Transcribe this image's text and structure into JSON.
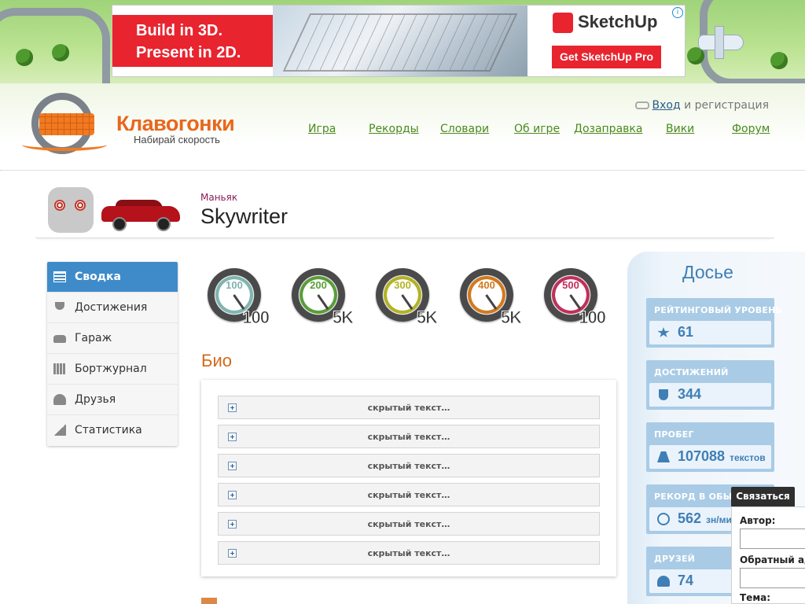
{
  "ad": {
    "headline_line1": "Build in 3D.",
    "headline_line2": "Present in 2D.",
    "brand": "SketchUp",
    "cta": "Get SketchUp Pro",
    "info_glyph": "i"
  },
  "site": {
    "logo_title": "Клавогонки",
    "logo_subtitle": "Набирай скорость",
    "login_link": "Вход",
    "login_rest": "и регистрация"
  },
  "nav": [
    {
      "label": "Игра"
    },
    {
      "label": "Рекорды"
    },
    {
      "label": "Словари"
    },
    {
      "label": "Об игре"
    },
    {
      "label": "Дозаправка"
    },
    {
      "label": "Вики"
    },
    {
      "label": "Форум"
    }
  ],
  "profile": {
    "rank": "Маньяк",
    "username": "Skywriter"
  },
  "sidebar": {
    "items": [
      {
        "label": "Сводка",
        "icon": "summary-icon",
        "active": true
      },
      {
        "label": "Достижения",
        "icon": "trophy-icon"
      },
      {
        "label": "Гараж",
        "icon": "car-icon"
      },
      {
        "label": "Бортжурнал",
        "icon": "logbook-icon"
      },
      {
        "label": "Друзья",
        "icon": "friends-icon"
      },
      {
        "label": "Статистика",
        "icon": "stats-icon"
      }
    ]
  },
  "badges": [
    {
      "speed": "100",
      "count": "100",
      "color": "#7fb5b0"
    },
    {
      "speed": "200",
      "count": "5K",
      "color": "#5a9e3a"
    },
    {
      "speed": "300",
      "count": "5K",
      "color": "#b3b225"
    },
    {
      "speed": "400",
      "count": "5K",
      "color": "#d27a1e"
    },
    {
      "speed": "500",
      "count": "100",
      "color": "#c0305a"
    }
  ],
  "bio": {
    "title": "Био",
    "spoilers": [
      "скрытый текст…",
      "скрытый текст…",
      "скрытый текст…",
      "скрытый текст…",
      "скрытый текст…",
      "скрытый текст…"
    ]
  },
  "dossier": {
    "title": "Досье",
    "cards": [
      {
        "label": "РЕЙТИНГОВЫЙ УРОВЕНЬ",
        "value": "61",
        "unit": "",
        "icon": "star-icon"
      },
      {
        "label": "ДОСТИЖЕНИЙ",
        "value": "344",
        "unit": "",
        "icon": "trophy-icon"
      },
      {
        "label": "ПРОБЕГ",
        "value": "107088",
        "unit": "текстов",
        "icon": "road-icon"
      },
      {
        "label": "РЕКОРД В ОБЫЧН",
        "value": "562",
        "unit": "зн/мин",
        "icon": "gauge-icon"
      },
      {
        "label": "ДРУЗЕЙ",
        "value": "74",
        "unit": "",
        "icon": "friends-icon"
      }
    ]
  },
  "contact": {
    "button": "Связаться",
    "author_label": "Автор:",
    "reply_label": "Обратный ад",
    "subject_label": "Тема:"
  },
  "colors": {
    "accent_blue": "#3f8bc9",
    "bio_orange": "#d26a1a",
    "nav_green": "#4a8a1c",
    "ad_red": "#e8242f"
  }
}
